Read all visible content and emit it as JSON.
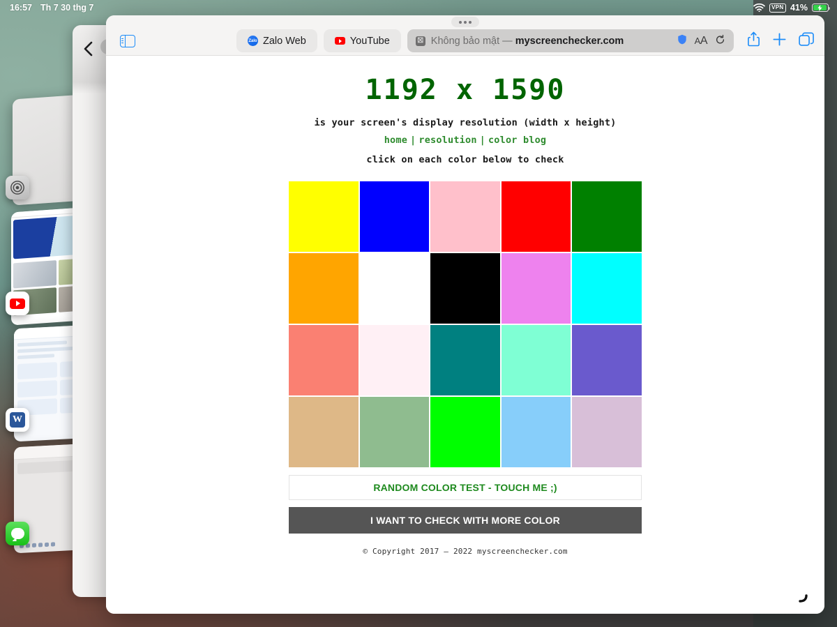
{
  "status_bar": {
    "time": "16:57",
    "date": "Th 7 30 thg 7",
    "wifi_icon": "wifi-icon",
    "vpn_label": "VPN",
    "battery_percent": "41%",
    "battery_icon": "battery-charging-icon"
  },
  "app_switcher": {
    "cards": [
      {
        "name": "settings",
        "icon": "settings-gear-icon"
      },
      {
        "name": "youtube",
        "icon": "youtube-icon"
      },
      {
        "name": "word",
        "icon": "word-icon",
        "icon_letter": "W"
      },
      {
        "name": "messages",
        "icon": "messages-icon"
      }
    ],
    "back_chevron": "chevron-left-icon"
  },
  "browser": {
    "drag_handle": "multitask-handle",
    "sidebar_toggle_icon": "sidebar-icon",
    "tabs": [
      {
        "label": "Zalo Web",
        "favicon": "zalo-favicon",
        "favicon_text": "Zalo",
        "active": false
      },
      {
        "label": "YouTube",
        "favicon": "youtube-favicon",
        "active": false
      }
    ],
    "address_bar": {
      "security_icon": "insecure-icon",
      "security_glyph": "☒",
      "warning_text": "Không bảo mật — ",
      "host": "myscreenchecker.com",
      "shield_icon": "shield-icon",
      "text_size_label": "AA",
      "reload_icon": "reload-icon"
    },
    "actions": [
      {
        "name": "share-button",
        "icon": "share-icon"
      },
      {
        "name": "new-tab-button",
        "icon": "plus-icon"
      },
      {
        "name": "tab-overview-button",
        "icon": "tabs-icon"
      }
    ]
  },
  "page": {
    "resolution_title": "1192 x 1590",
    "subtitle": "is your screen's display resolution (width x height)",
    "nav": [
      {
        "label": "home"
      },
      {
        "label": "resolution"
      },
      {
        "label": "color blog"
      }
    ],
    "nav_separator": "|",
    "instruction": "click on each color below to check",
    "swatches": [
      {
        "name": "yellow",
        "hex": "#FFFF00"
      },
      {
        "name": "blue",
        "hex": "#0000FF"
      },
      {
        "name": "pink",
        "hex": "#FFC0CB"
      },
      {
        "name": "red",
        "hex": "#FF0000"
      },
      {
        "name": "green",
        "hex": "#008000"
      },
      {
        "name": "orange",
        "hex": "#FFA500"
      },
      {
        "name": "white",
        "hex": "#FFFFFF"
      },
      {
        "name": "black",
        "hex": "#000000"
      },
      {
        "name": "violet",
        "hex": "#EE82EE"
      },
      {
        "name": "cyan",
        "hex": "#00FFFF"
      },
      {
        "name": "salmon",
        "hex": "#FA8072"
      },
      {
        "name": "lavenderblush",
        "hex": "#FFF0F5"
      },
      {
        "name": "teal",
        "hex": "#008080"
      },
      {
        "name": "aquamarine",
        "hex": "#7FFFD4"
      },
      {
        "name": "slateblue",
        "hex": "#6A5ACD"
      },
      {
        "name": "burlywood",
        "hex": "#DEB887"
      },
      {
        "name": "darkseagreen",
        "hex": "#8FBC8F"
      },
      {
        "name": "lime",
        "hex": "#00FF00"
      },
      {
        "name": "lightskyblue",
        "hex": "#87CEFA"
      },
      {
        "name": "thistle",
        "hex": "#D8BFD8"
      }
    ],
    "random_button": "RANDOM COLOR TEST - TOUCH ME ;)",
    "more_button": "I WANT TO CHECK WITH MORE COLOR",
    "copyright": "© Copyright 2017 — 2022 myscreenchecker.com"
  },
  "colors": {
    "title_green": "#006400",
    "link_green": "#2E8B2E",
    "more_button_bg": "#555555",
    "accent_blue": "#1C8CF8"
  }
}
